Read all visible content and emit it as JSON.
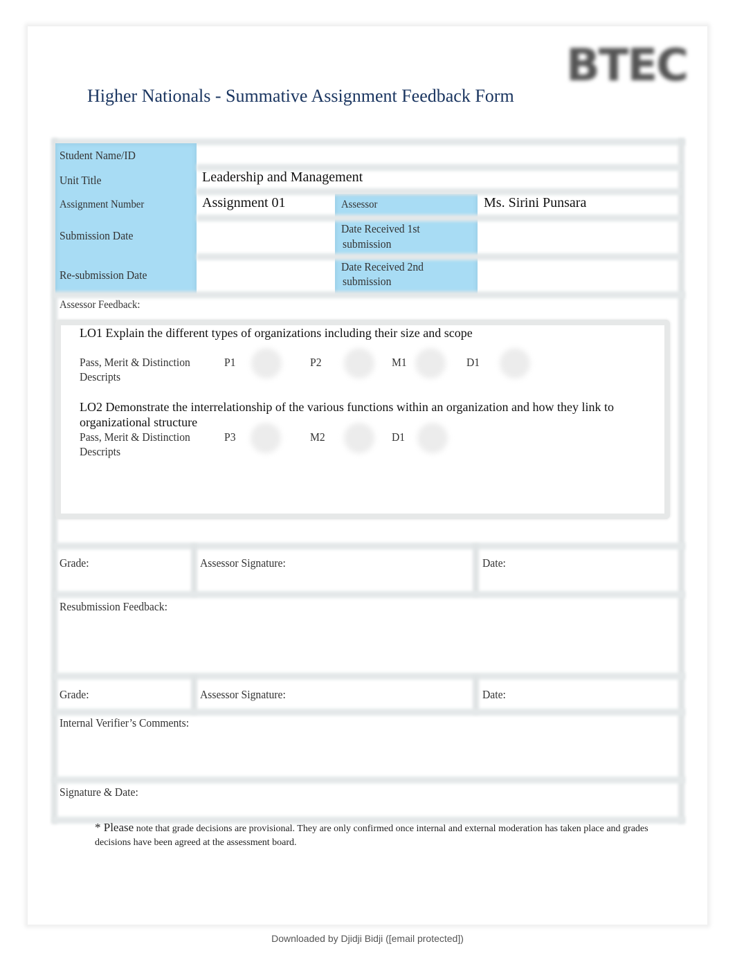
{
  "header": {
    "logo_text": "BTEC",
    "title": "Higher Nationals - Summative Assignment Feedback Form"
  },
  "details": {
    "student_name_label": "Student Name/ID",
    "student_name_value": "",
    "unit_title_label": "Unit Title",
    "unit_title_value": "Leadership and Management",
    "assignment_number_label": "Assignment  Number",
    "assignment_number_value": "Assignment 01",
    "assessor_label": "Assessor",
    "assessor_value": "Ms. Sirini Punsara",
    "submission_date_label": "Submission Date",
    "submission_date_value": "",
    "date_received_1_label_line1": "Date Received 1st",
    "date_received_1_label_line2": "submission",
    "date_received_1_value": "",
    "resubmission_date_label": "Re-submission Date",
    "resubmission_date_value": "",
    "date_received_2_label_line1": "Date Received 2nd",
    "date_received_2_label_line2": "submission",
    "date_received_2_value": ""
  },
  "feedback": {
    "assessor_feedback_label": "Assessor  Feedback:",
    "lo1": {
      "text": "LO1 Explain the different types of organizations including their size and scope",
      "descripts_line1": "Pass, Merit & Distinction",
      "descripts_line2": "Descripts",
      "criteria": [
        "P1",
        "P2",
        "M1",
        "D1"
      ]
    },
    "lo2": {
      "text_line1": "LO2 Demonstrate the interrelationship of the various functions within an organization and how they link to",
      "text_line2": "organizational structure",
      "descripts_line1": "Pass, Merit & Distinction",
      "descripts_line2": "Descripts",
      "criteria": [
        "P3",
        "M2",
        "D1"
      ]
    }
  },
  "signoff_1": {
    "grade_label": "Grade:",
    "assessor_signature_label": "Assessor Signature:",
    "date_label": "Date:"
  },
  "resubmission_feedback_label": "Resubmission Feedback:",
  "signoff_2": {
    "grade_label": "Grade:",
    "assessor_signature_label": "Assessor Signature:",
    "date_label": "Date:"
  },
  "internal_verifier_label": "Internal Verifier’s Comments:",
  "signature_date_label": "Signature & Date:",
  "note": {
    "lead": "* Please",
    "text": " note that grade decisions are provisional. They are only confirmed once internal and external moderation has taken place and grades decisions have been agreed at the assessment board."
  },
  "footer": {
    "downloaded_by": "Downloaded by Djidji Bidji ([email protected])"
  }
}
